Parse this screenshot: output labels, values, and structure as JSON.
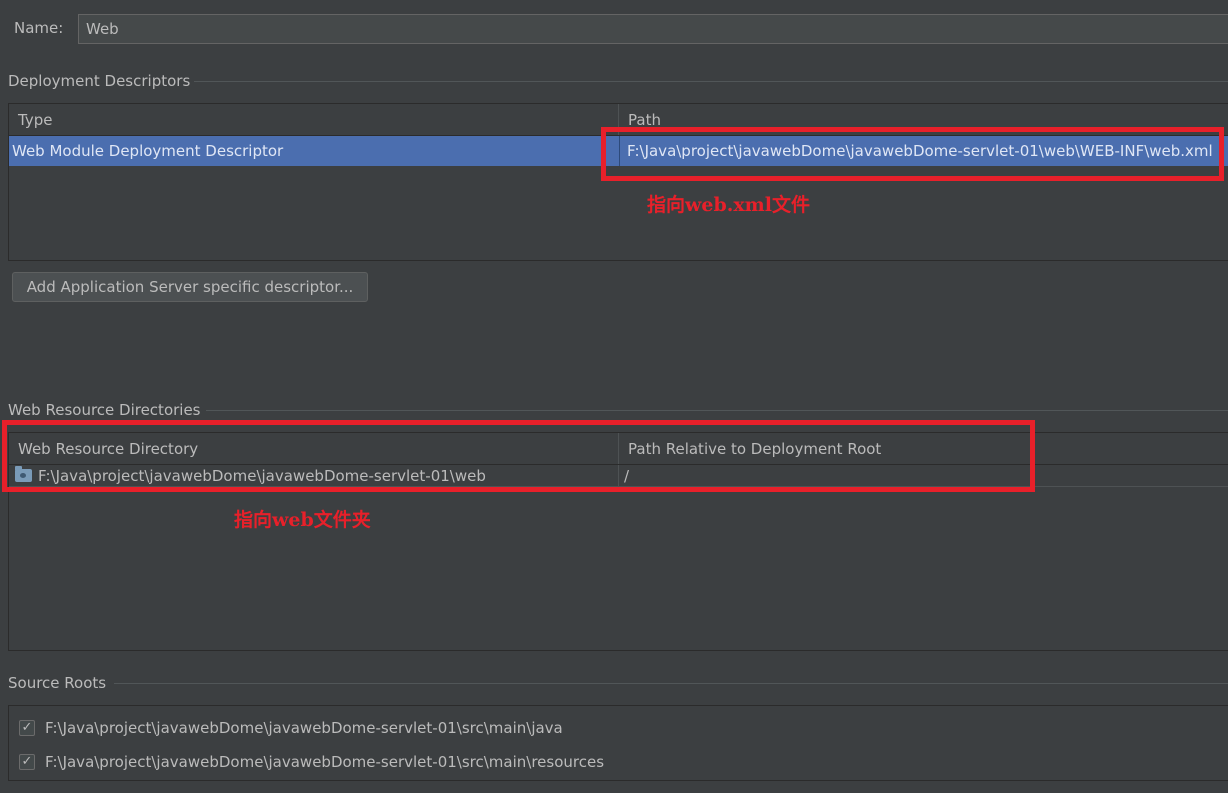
{
  "name": {
    "label": "Name:",
    "value": "Web"
  },
  "deployment_descriptors": {
    "title": "Deployment Descriptors",
    "columns": [
      "Type",
      "Path"
    ],
    "rows": [
      {
        "type": "Web Module Deployment Descriptor",
        "path": "F:\\Java\\project\\javawebDome\\javawebDome-servlet-01\\web\\WEB-INF\\web.xml"
      }
    ],
    "add_button_label": "Add Application Server specific descriptor..."
  },
  "web_resource_directories": {
    "title": "Web Resource Directories",
    "columns": [
      "Web Resource Directory",
      "Path Relative to Deployment Root"
    ],
    "rows": [
      {
        "icon": "folder-icon",
        "directory": "F:\\Java\\project\\javawebDome\\javawebDome-servlet-01\\web",
        "relative_path": "/"
      }
    ]
  },
  "source_roots": {
    "title": "Source Roots",
    "items": [
      {
        "checked": true,
        "path": "F:\\Java\\project\\javawebDome\\javawebDome-servlet-01\\src\\main\\java"
      },
      {
        "checked": true,
        "path": "F:\\Java\\project\\javawebDome\\javawebDome-servlet-01\\src\\main\\resources"
      }
    ]
  },
  "annotations": {
    "webxml_note": "指向web.xml文件",
    "webfolder_note": "指向web文件夹",
    "color": "#e8202a"
  },
  "theme": {
    "background": "#3c3f41",
    "selection": "#4b6eaf",
    "text": "#bbbbbb"
  }
}
